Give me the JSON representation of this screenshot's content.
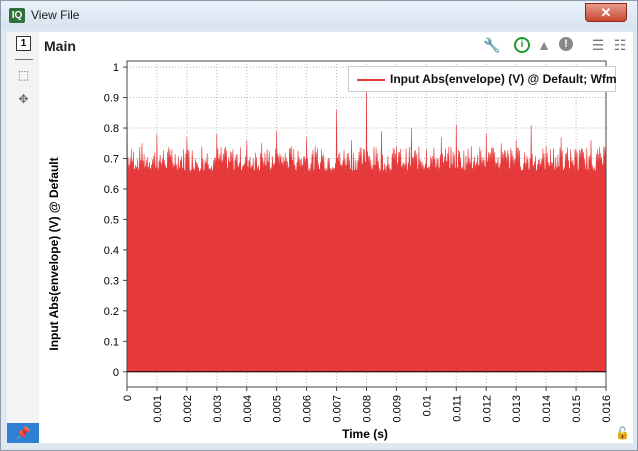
{
  "window": {
    "title": "View File",
    "app_icon": "IQ",
    "close_label": "✕"
  },
  "toolstrip": {
    "page_number": "1"
  },
  "panel": {
    "title": "Main"
  },
  "icons": {
    "wrench": "wrench-icon",
    "info": "info-icon",
    "warning": "warning-icon",
    "error": "error-icon",
    "list1": "list-icon",
    "list2": "list-detail-icon",
    "lock": "unlock-icon"
  },
  "colors": {
    "series": "#e5393a",
    "accent": "#2f7fd4"
  },
  "chart_data": {
    "type": "area",
    "title": "",
    "xlabel": "Time (s)",
    "ylabel": "Input Abs(envelope) (V) @ Default",
    "xlim": [
      0,
      0.016
    ],
    "ylim": [
      -0.05,
      1.02
    ],
    "x_ticks": [
      "0",
      "0.001",
      "0.002",
      "0.003",
      "0.004",
      "0.005",
      "0.006",
      "0.007",
      "0.008",
      "0.009",
      "0.01",
      "0.011",
      "0.012",
      "0.013",
      "0.014",
      "0.015",
      "0.016"
    ],
    "y_ticks": [
      "0",
      "0.1",
      "0.2",
      "0.3",
      "0.4",
      "0.5",
      "0.6",
      "0.7",
      "0.8",
      "0.9",
      "1"
    ],
    "legend": "top-right",
    "series": [
      {
        "name": "Input Abs(envelope) (V) @ Default; Wfm",
        "x": [
          0,
          0.0005,
          0.001,
          0.0015,
          0.002,
          0.0025,
          0.003,
          0.0035,
          0.004,
          0.0045,
          0.005,
          0.0055,
          0.006,
          0.0065,
          0.007,
          0.0075,
          0.008,
          0.0085,
          0.009,
          0.0095,
          0.01,
          0.0105,
          0.011,
          0.0115,
          0.012,
          0.0125,
          0.013,
          0.0135,
          0.014,
          0.0145,
          0.015,
          0.0155,
          0.016
        ],
        "values": [
          0.94,
          0.75,
          0.78,
          0.73,
          0.77,
          0.74,
          0.78,
          0.72,
          0.76,
          0.75,
          0.79,
          0.74,
          0.77,
          0.73,
          0.86,
          0.76,
          0.93,
          0.79,
          0.74,
          0.8,
          0.73,
          0.77,
          0.81,
          0.74,
          0.78,
          0.75,
          0.76,
          0.81,
          0.74,
          0.77,
          0.73,
          0.76,
          0.76
        ]
      }
    ]
  }
}
